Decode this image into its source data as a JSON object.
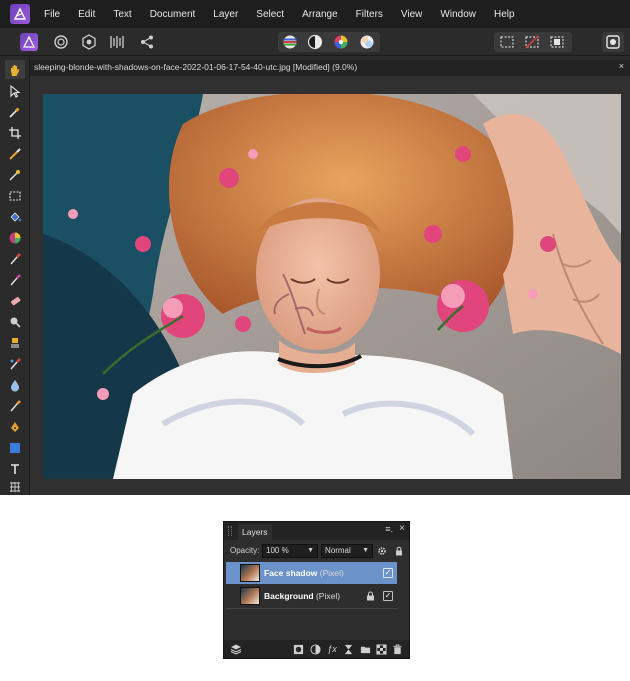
{
  "menu": [
    "File",
    "Edit",
    "Text",
    "Document",
    "Layer",
    "Select",
    "Arrange",
    "Filters",
    "View",
    "Window",
    "Help"
  ],
  "document": {
    "title": "sleeping-blonde-with-shadows-on-face-2022-01-06-17-54-40-utc.jpg [Modified] (9.0%)",
    "close": "×"
  },
  "layers_panel": {
    "tab": "Layers",
    "menu_glyph": "≡.",
    "close_glyph": "×",
    "opacity_label": "Opacity:",
    "opacity_value": "100 %",
    "blend_mode": "Normal",
    "layers": [
      {
        "name": "Face shadow",
        "type": "(Pixel)",
        "selected": true,
        "visible": true,
        "locked": false
      },
      {
        "name": "Background",
        "type": "(Pixel)",
        "selected": false,
        "visible": true,
        "locked": true
      }
    ],
    "check_glyph": "✓"
  },
  "colors": {
    "accent": "#6b3fb8",
    "selection": "#6b93c9"
  }
}
